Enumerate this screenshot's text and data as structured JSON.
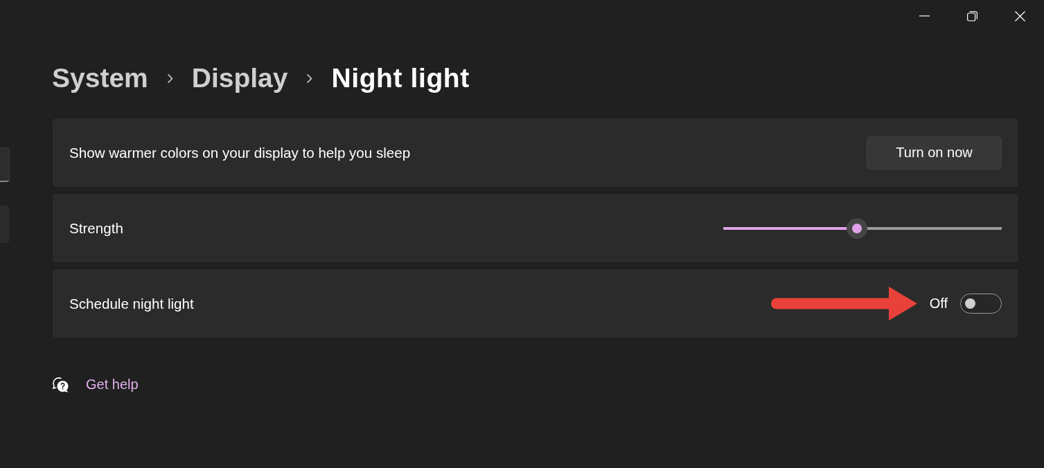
{
  "window": {
    "controls": [
      {
        "kind": "minimize"
      },
      {
        "kind": "restore"
      },
      {
        "kind": "close"
      }
    ]
  },
  "sidebar": {
    "items": [
      {
        "kind": "field"
      },
      {
        "kind": "item"
      }
    ]
  },
  "breadcrumb": [
    {
      "label": "System",
      "current": false
    },
    {
      "label": "Display",
      "current": false
    },
    {
      "label": "Night light",
      "current": true
    }
  ],
  "settings": [
    {
      "kind": "button",
      "label": "Show warmer colors on your display to help you sleep",
      "button": "Turn on now"
    },
    {
      "kind": "slider",
      "label": "Strength",
      "level": 0.48
    },
    {
      "kind": "toggle",
      "label": "Schedule night light",
      "on": false,
      "state_text": "Off",
      "pointer_arrow": true
    }
  ],
  "help_link": {
    "label": "Get help"
  }
}
